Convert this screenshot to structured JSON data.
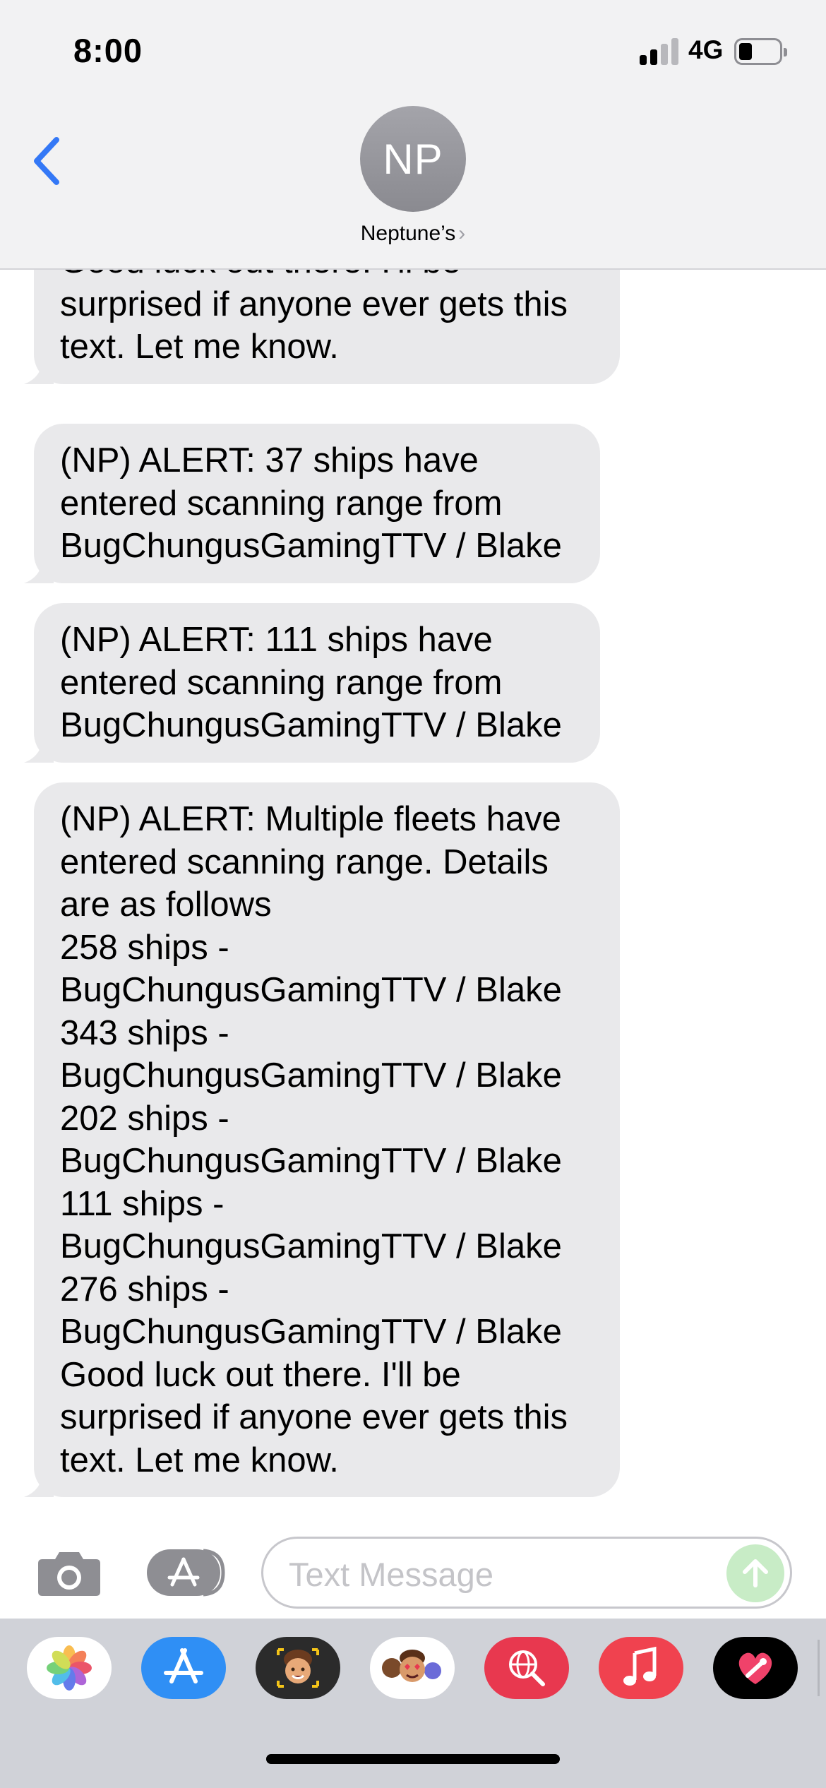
{
  "status_bar": {
    "time": "8:00",
    "network": "4G",
    "signal_bars": 2,
    "signal_max": 4,
    "battery_level": 0.2
  },
  "header": {
    "back_icon": "chevron-left-icon",
    "avatar_initials": "NP",
    "contact_name": "Neptune’s",
    "contact_chevron": "›"
  },
  "messages": [
    {
      "lines": [
        "Good luck out there. I'll be",
        "surprised if anyone ever gets this",
        "text. Let me know."
      ]
    },
    {
      "lines": [
        "(NP) ALERT: 37 ships have",
        "entered scanning range from",
        "BugChungusGamingTTV / Blake"
      ]
    },
    {
      "lines": [
        "(NP) ALERT: 111 ships have",
        "entered scanning range from",
        "BugChungusGamingTTV / Blake"
      ]
    },
    {
      "lines": [
        "(NP) ALERT: Multiple fleets have",
        "entered scanning range. Details",
        "are as follows",
        "258 ships -",
        "BugChungusGamingTTV / Blake",
        "343 ships -",
        "BugChungusGamingTTV / Blake",
        "202 ships -",
        "BugChungusGamingTTV / Blake",
        "111 ships -",
        "BugChungusGamingTTV / Blake",
        "276 ships -",
        "BugChungusGamingTTV / Blake",
        "Good luck out there. I'll be",
        "surprised if anyone ever gets this",
        "text. Let me know."
      ]
    }
  ],
  "compose": {
    "placeholder": "Text Message",
    "camera_icon": "camera-icon",
    "apps_icon": "app-store-icon",
    "send_icon": "arrow-up-icon"
  },
  "app_drawer": [
    {
      "name": "photos",
      "icon": "photos-icon"
    },
    {
      "name": "app-store",
      "icon": "app-store-icon"
    },
    {
      "name": "memoji-camera",
      "icon": "memoji-camera-icon"
    },
    {
      "name": "memoji-stickers",
      "icon": "memoji-stickers-icon"
    },
    {
      "name": "web-images",
      "icon": "globe-search-icon"
    },
    {
      "name": "music",
      "icon": "music-note-icon"
    },
    {
      "name": "digital-touch",
      "icon": "heart-touch-icon"
    }
  ],
  "colors": {
    "accent_blue": "#3478f6",
    "bubble_gray": "#e9e9eb",
    "header_bg": "#f2f2f3",
    "send_green": "#c8ecc6",
    "drawer_bg": "#d0d2d8"
  }
}
